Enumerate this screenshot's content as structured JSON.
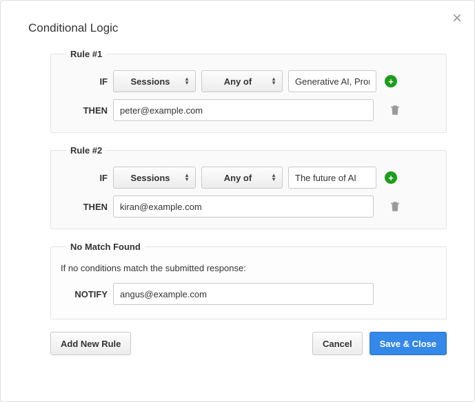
{
  "title": "Conditional Logic",
  "close_glyph": "×",
  "plus_glyph": "+",
  "labels": {
    "if": "IF",
    "then": "THEN",
    "notify": "NOTIFY"
  },
  "rules": [
    {
      "legend": "Rule #1",
      "field": "Sessions",
      "operator": "Any of",
      "value": "Generative AI, Pron",
      "then": "peter@example.com"
    },
    {
      "legend": "Rule #2",
      "field": "Sessions",
      "operator": "Any of",
      "value": "The future of AI",
      "then": "kiran@example.com"
    }
  ],
  "nomatch": {
    "legend": "No Match Found",
    "text": "If no conditions match the submitted response:",
    "notify": "angus@example.com"
  },
  "footer": {
    "add": "Add New Rule",
    "cancel": "Cancel",
    "save": "Save & Close"
  }
}
